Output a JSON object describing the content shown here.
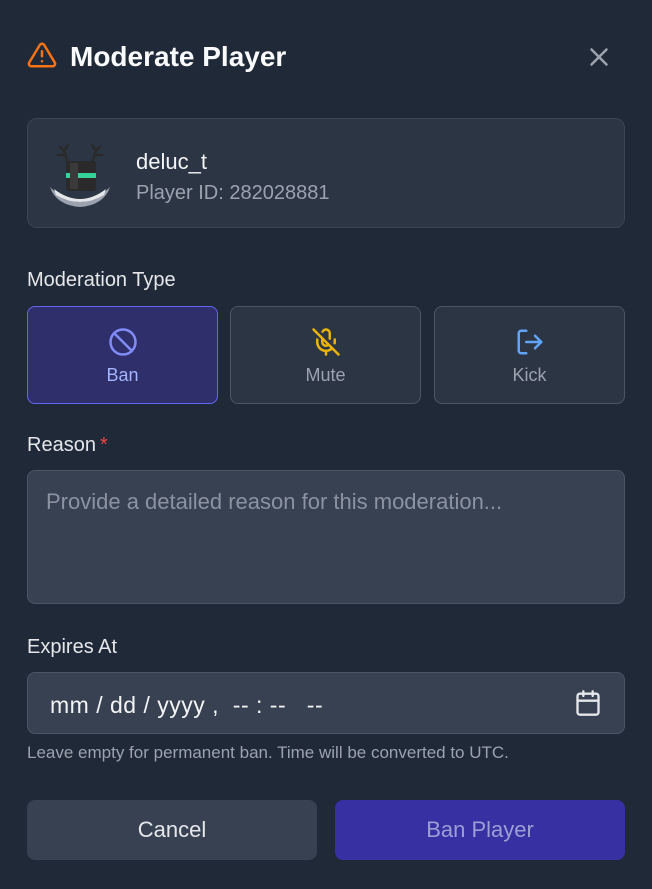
{
  "dialog": {
    "title": "Moderate Player",
    "title_icon": "warning-triangle-icon",
    "close_icon": "close-icon"
  },
  "player": {
    "name": "deluc_t",
    "id_text": "Player ID: 282028881",
    "avatar_icon": "player-avatar"
  },
  "moderation": {
    "label": "Moderation Type",
    "selected": "Ban",
    "types": [
      {
        "label": "Ban",
        "icon": "ban-icon",
        "color": "#818cf8"
      },
      {
        "label": "Mute",
        "icon": "mic-off-icon",
        "color": "#eab308"
      },
      {
        "label": "Kick",
        "icon": "logout-icon",
        "color": "#60a5fa"
      }
    ]
  },
  "reason": {
    "label": "Reason",
    "required_mark": "*",
    "placeholder": "Provide a detailed reason for this moderation...",
    "value": ""
  },
  "expires": {
    "label": "Expires At",
    "value_text": "mm / dd / yyyy ,  -- : --   --",
    "calendar_icon": "calendar-icon",
    "hint": "Leave empty for permanent ban. Time will be converted to UTC."
  },
  "actions": {
    "cancel_label": "Cancel",
    "submit_label": "Ban Player"
  },
  "colors": {
    "background": "#1f2937",
    "accent": "#6366f1",
    "warning": "#f97316",
    "required": "#ef4444"
  }
}
